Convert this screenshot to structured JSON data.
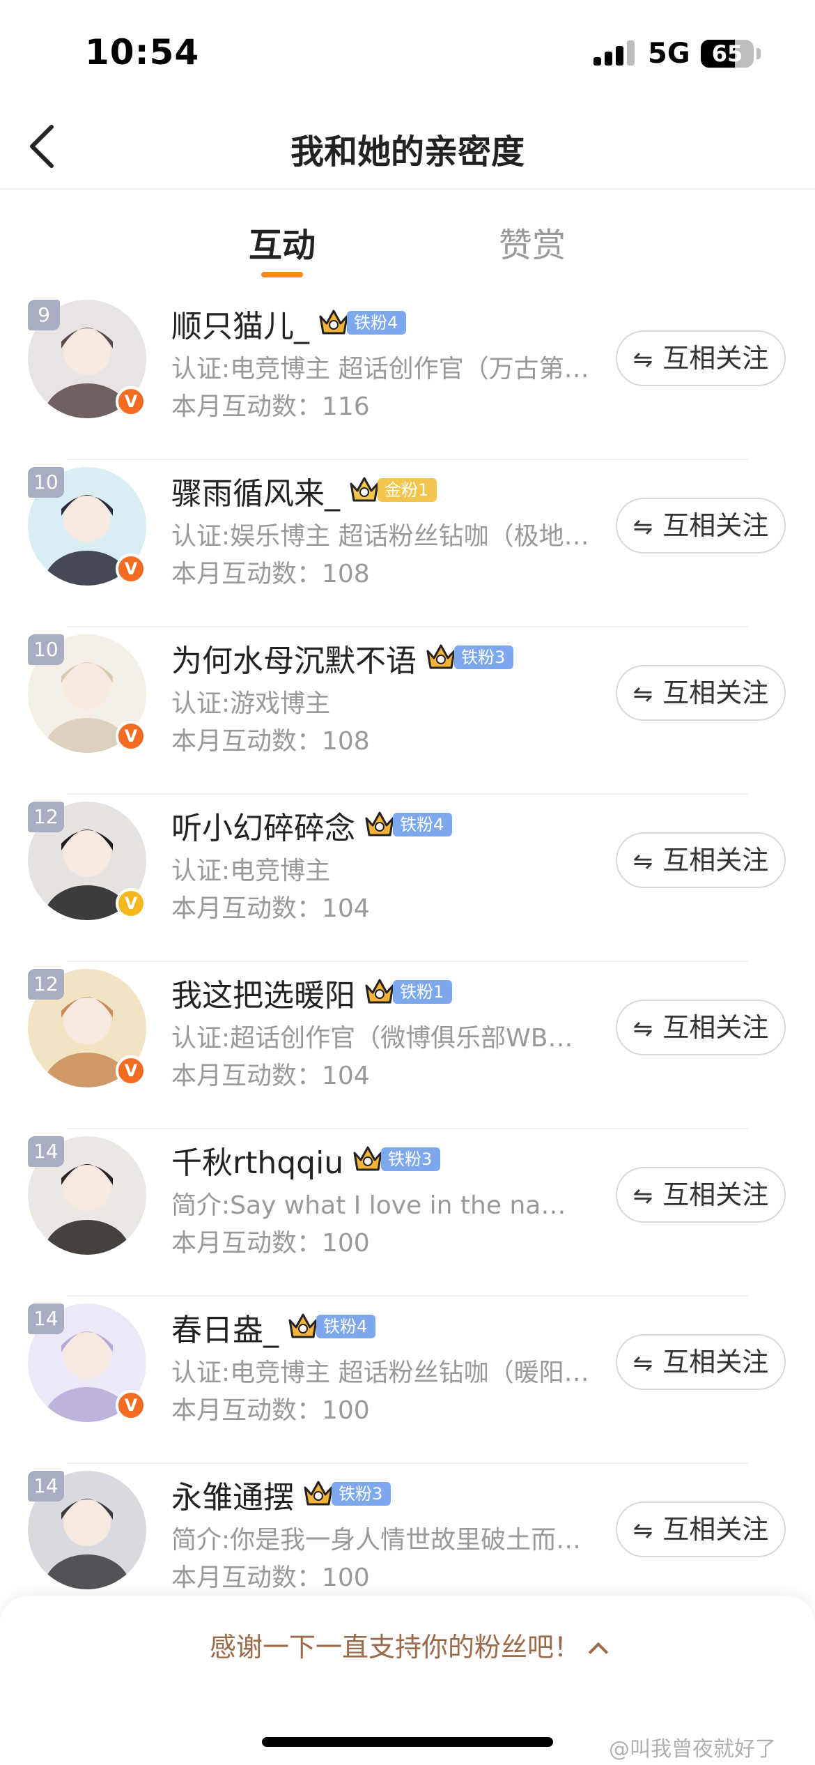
{
  "status_bar": {
    "time": "10:54",
    "network": "5G",
    "battery": "65",
    "battery_level": 0.65
  },
  "header": {
    "back_icon": "chevron-left-icon",
    "title": "我和她的亲密度"
  },
  "tabs": [
    {
      "label": "互动",
      "active": true
    },
    {
      "label": "赞赏",
      "active": false
    }
  ],
  "colors": {
    "accent": "#f7891f",
    "orange_v": "#f26b21",
    "gold_v": "#f4b81c",
    "iron_tag": "#7ea8ee",
    "gold_tag": "#f2c54c",
    "rank_badge": "#a9adc4"
  },
  "follow_label": "互相关注",
  "follow_icon": "swap-arrows-icon",
  "rows": [
    {
      "rank": "9",
      "name": "顺只猫儿_",
      "fan": "铁粉4",
      "fan_type": "iron",
      "desc": "认证:电竞博主 超话创作官（万古第…",
      "count": "本月互动数：116",
      "v": "orange"
    },
    {
      "rank": "10",
      "name": "骤雨循风来_",
      "fan": "金粉1",
      "fan_type": "gold",
      "desc": "认证:娱乐博主 超话粉丝钻咖（极地…",
      "count": "本月互动数：108",
      "v": "orange"
    },
    {
      "rank": "10",
      "name": "为何水母沉默不语",
      "fan": "铁粉3",
      "fan_type": "iron",
      "desc": "认证:游戏博主",
      "count": "本月互动数：108",
      "v": "orange"
    },
    {
      "rank": "12",
      "name": "听小幻碎碎念",
      "fan": "铁粉4",
      "fan_type": "iron",
      "desc": "认证:电竞博主",
      "count": "本月互动数：104",
      "v": "gold"
    },
    {
      "rank": "12",
      "name": "我这把选暖阳",
      "fan": "铁粉1",
      "fan_type": "iron",
      "desc": "认证:超话创作官（微博俱乐部WB王…",
      "count": "本月互动数：104",
      "v": "orange"
    },
    {
      "rank": "14",
      "name": "千秋rthqqiu",
      "fan": "铁粉3",
      "fan_type": "iron",
      "desc": "简介:Say what I love in the na…",
      "count": "本月互动数：100",
      "v": "none"
    },
    {
      "rank": "14",
      "name": "春日盎_",
      "fan": "铁粉4",
      "fan_type": "iron",
      "desc": "认证:电竞博主 超话粉丝钻咖（暖阳…",
      "count": "本月互动数：100",
      "v": "orange"
    },
    {
      "rank": "14",
      "name": "永雏通摆",
      "fan": "铁粉3",
      "fan_type": "iron",
      "desc": "简介:你是我一身人情世故里破土而…",
      "count": "本月互动数：100",
      "v": "none"
    }
  ],
  "bottom_sheet": {
    "text": "感谢一下一直支持你的粉丝吧！",
    "chevron_icon": "chevron-up-icon"
  },
  "watermark": "@叫我曾夜就好了"
}
